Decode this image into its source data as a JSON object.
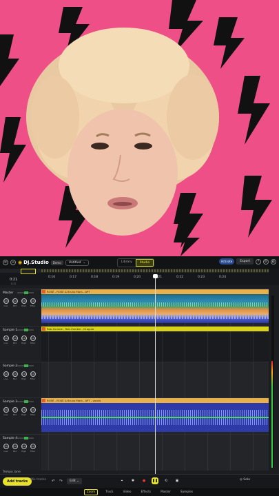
{
  "app": {
    "logo_text": "DJ.Studio",
    "badge": "Demo",
    "project_name": "Untitled",
    "tabs": [
      "Library",
      "Studio"
    ],
    "active_tab": "Studio",
    "status": "Activate",
    "export_label": "Export"
  },
  "ruler": {
    "labels": [
      "0:16",
      "0:17",
      "0:18",
      "0:19",
      "0:20",
      "0:21",
      "0:22",
      "0:23",
      "0:24"
    ],
    "position": "0:21",
    "position_sub": "0:22",
    "bpm": "146.0"
  },
  "tracks": [
    {
      "name": "Master",
      "knobs": [
        "Low",
        "Mid",
        "High",
        "Filter"
      ],
      "clip": "ROSÉ - ROSÉ & Bruno Mars - APT"
    },
    {
      "name": "Sample 1",
      "knobs": [
        "Low",
        "Mid",
        "High",
        "Filter"
      ],
      "clip": "Rob Zombie - Rob Zombie - Dragula"
    },
    {
      "name": "Sample 2",
      "knobs": [
        "Low",
        "Mid",
        "High",
        "Filter"
      ],
      "clip": ""
    },
    {
      "name": "Sample 3",
      "knobs": [
        "Low",
        "Mid",
        "High",
        "Filter"
      ],
      "clip": "ROSÉ - ROSÉ & Bruno Mars - APT - vocals"
    },
    {
      "name": "Sample 4",
      "knobs": [
        "Low",
        "Mid",
        "High",
        "Filter"
      ],
      "clip": ""
    }
  ],
  "knob_value": "0.0",
  "tempo_label": "Tempo lane",
  "controls": {
    "add_tracks": "Add tracks",
    "mix_tracks": "Mix tracks",
    "edit": "Edit",
    "solo": "Solo"
  },
  "bottom_tabs": [
    "Zoom",
    "Track",
    "Video",
    "Effects",
    "Master",
    "Samples"
  ],
  "active_bottom_tab": "Zoom",
  "zoom_percent": "13%",
  "colors": {
    "accent": "#e9e22c",
    "video_bg": "#ee4f86",
    "bolt": "#111111"
  }
}
